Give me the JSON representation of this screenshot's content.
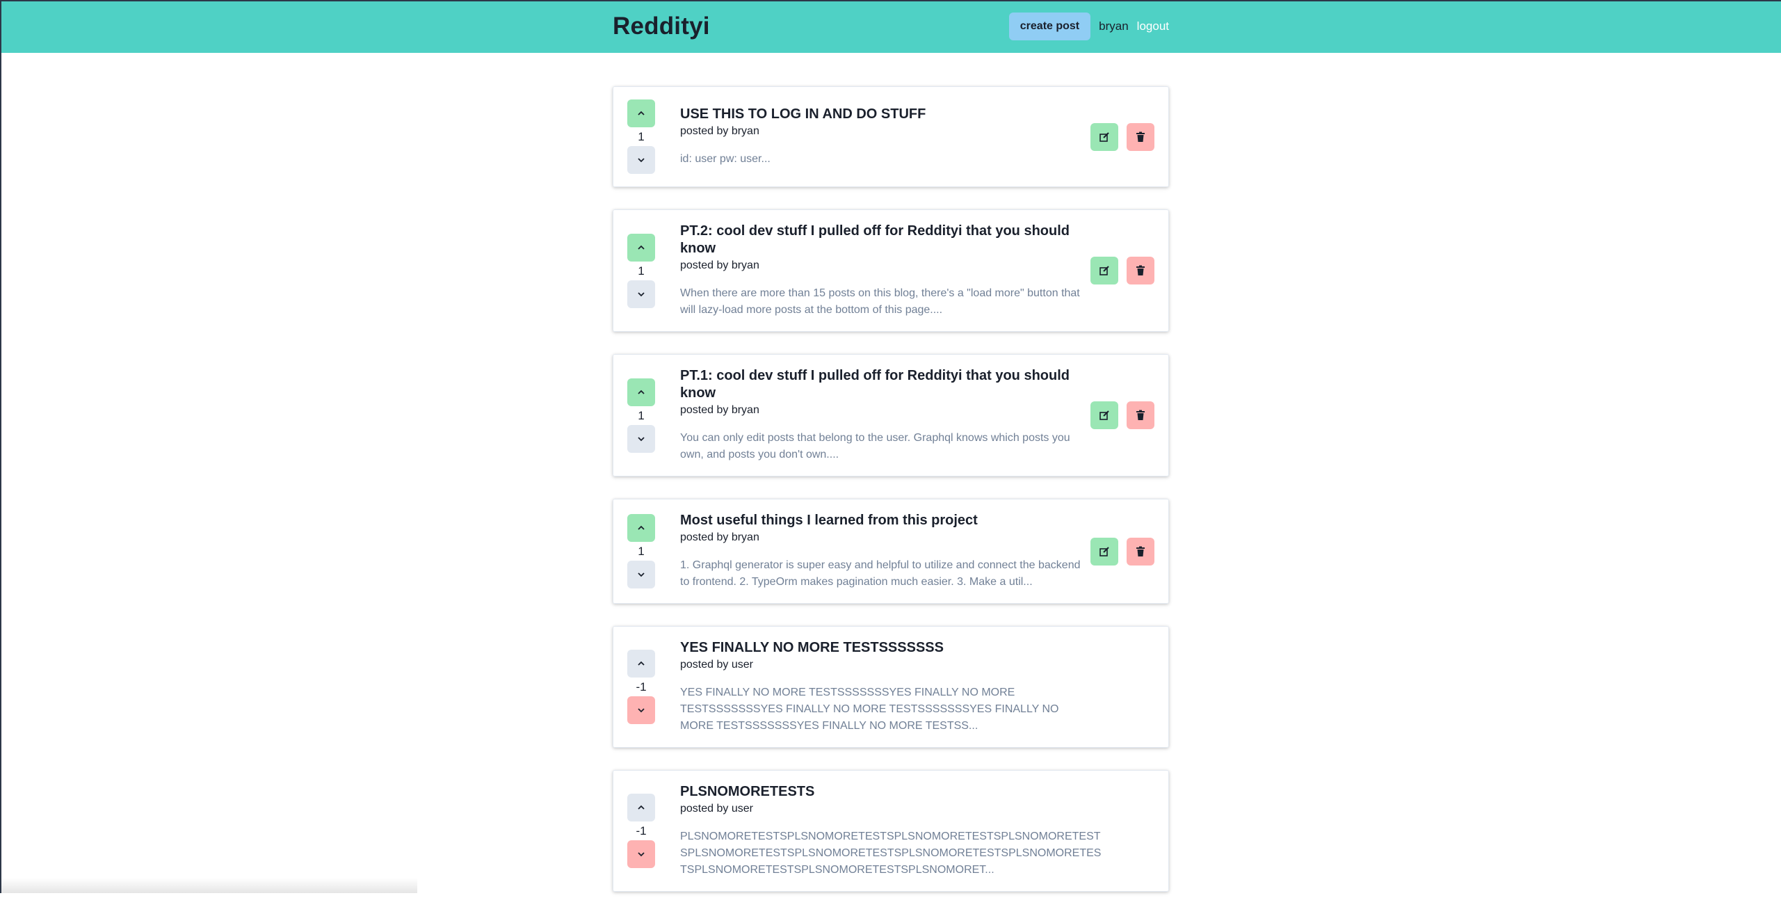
{
  "navbar": {
    "brand": "Reddityi",
    "create_post_label": "create post",
    "username": "bryan",
    "logout_label": "logout"
  },
  "posts": [
    {
      "title": "USE THIS TO LOG IN AND DO STUFF",
      "author_line": "posted by bryan",
      "snippet": "id: user pw: user...",
      "points": "1",
      "vote_state": "up",
      "owned": true
    },
    {
      "title": "PT.2: cool dev stuff I pulled off for Reddityi that you should know",
      "author_line": "posted by bryan",
      "snippet": "When there are more than 15 posts on this blog, there's a \"load more\" button that will lazy-load more posts at the bottom of this page....",
      "points": "1",
      "vote_state": "up",
      "owned": true
    },
    {
      "title": "PT.1: cool dev stuff I pulled off for Reddityi that you should know",
      "author_line": "posted by bryan",
      "snippet": "You can only edit posts that belong to the user. Graphql knows which posts you own, and posts you don't own....",
      "points": "1",
      "vote_state": "up",
      "owned": true
    },
    {
      "title": "Most useful things I learned from this project",
      "author_line": "posted by bryan",
      "snippet": "1. Graphql generator is super easy and helpful to utilize and connect the backend to frontend. 2. TypeOrm makes pagination much easier. 3. Make a util...",
      "points": "1",
      "vote_state": "up",
      "owned": true
    },
    {
      "title": "YES FINALLY NO MORE TESTSSSSSSS",
      "author_line": "posted by user",
      "snippet": "YES FINALLY NO MORE TESTSSSSSSSYES FINALLY NO MORE TESTSSSSSSSYES FINALLY NO MORE TESTSSSSSSSYES FINALLY NO MORE TESTSSSSSSSYES FINALLY NO MORE TESTSS...",
      "points": "-1",
      "vote_state": "down",
      "owned": false
    },
    {
      "title": "PLSNOMORETESTS",
      "author_line": "posted by user",
      "snippet": "PLSNOMORETESTSPLSNOMORETESTSPLSNOMORETESTSPLSNOMORETEST SPLSNOMORETESTSPLSNOMORETESTSPLSNOMORETESTSPLSNOMORETES TSPLSNOMORETESTSPLSNOMORETESTSPLSNOMORET...",
      "points": "-1",
      "vote_state": "down",
      "owned": false
    }
  ],
  "icons": {
    "upvote": "chevron-up-icon",
    "downvote": "chevron-down-icon",
    "edit": "edit-icon",
    "delete": "trash-icon"
  },
  "colors": {
    "navbar": "#4fd1c5",
    "create_button": "#90cdf4",
    "vote_active_up": "#9ae6b4",
    "vote_active_down": "#feb2b2",
    "vote_inactive": "#e2e8f0",
    "edit_button": "#9ae6b4",
    "delete_button": "#feb2b2"
  }
}
